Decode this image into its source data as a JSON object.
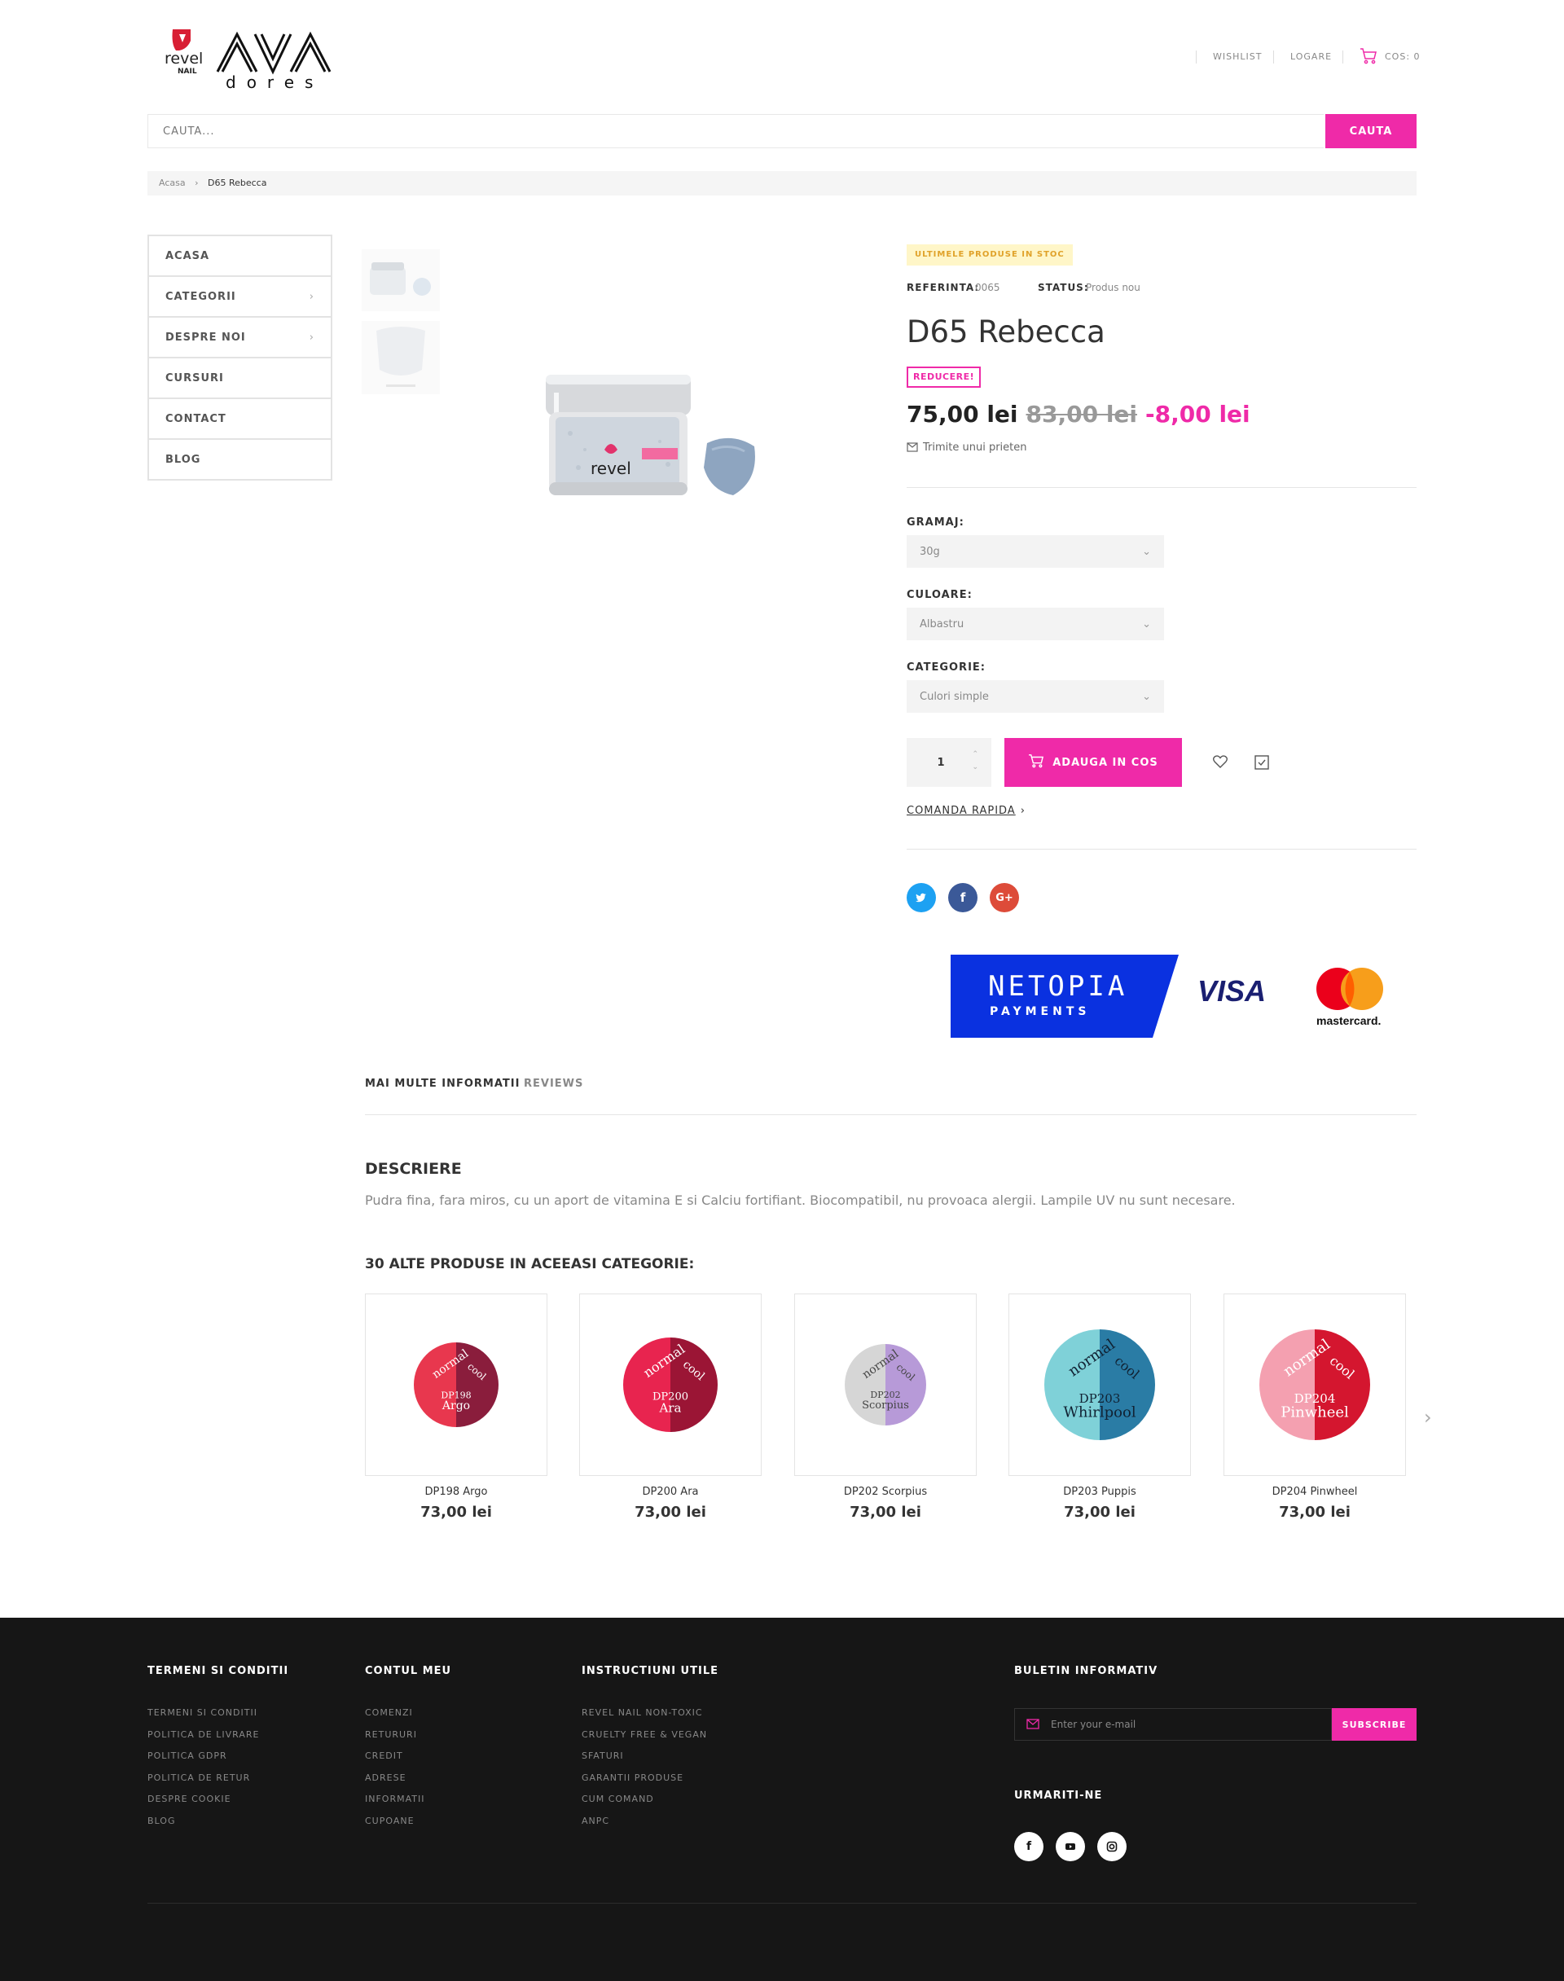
{
  "header": {
    "logo_revel_text": "revel",
    "logo_revel_sub": "NAIL",
    "logo_ava_text": "AVA",
    "logo_ava_sub": "dores",
    "wishlist": "WISHLIST",
    "login": "LOGARE",
    "cart": "COS: 0"
  },
  "search": {
    "placeholder": "CAUTA...",
    "button": "CAUTA"
  },
  "breadcrumb": {
    "home": "Acasa",
    "separator": "›",
    "current": "D65 Rebecca"
  },
  "menu": [
    {
      "label": "ACASA",
      "has_children": false
    },
    {
      "label": "CATEGORII",
      "has_children": true
    },
    {
      "label": "DESPRE NOI",
      "has_children": true
    },
    {
      "label": "CURSURI",
      "has_children": false
    },
    {
      "label": "CONTACT",
      "has_children": false
    },
    {
      "label": "BLOG",
      "has_children": false
    }
  ],
  "product": {
    "stock_badge": "ULTIMELE PRODUSE IN STOC",
    "ref_label": "REFERINTA:",
    "ref_value": "0065",
    "status_label": "STATUS:",
    "status_value": "Produs nou",
    "title": "D65 Rebecca",
    "jar_brand": "revel",
    "discount_badge": "REDUCERE!",
    "price": "75,00 lei",
    "old_price": "83,00 lei",
    "discount": "-8,00 lei",
    "send_friend": "Trimite unui prieten",
    "options": [
      {
        "label": "GRAMAJ:",
        "value": "30g"
      },
      {
        "label": "CULOARE:",
        "value": "Albastru"
      },
      {
        "label": "CATEGORIE:",
        "value": "Culori simple"
      }
    ],
    "quantity": "1",
    "add_to_cart": "ADAUGA IN COS",
    "quick_order": "COMANDA RAPIDA",
    "quick_order_arrow": "›"
  },
  "payment": {
    "netopia": "NETOPIA",
    "netopia_sub": "PAYMENTS",
    "visa": "VISA",
    "mastercard": "mastercard."
  },
  "tabs": [
    {
      "label": "MAI MULTE INFORMATII",
      "active": true
    },
    {
      "label": "REVIEWS",
      "active": false
    }
  ],
  "description": {
    "heading": "DESCRIERE",
    "text": "Pudra fina, fara miros, cu un aport de vitamina E si Calciu fortifiant. Biocompatibil, nu provoaca alergii. Lampile UV nu sunt necesare."
  },
  "related": {
    "heading": "30 ALTE PRODUSE IN ACEEASI CATEGORIE:",
    "items": [
      {
        "name": "DP198 Argo",
        "price": "73,00 lei",
        "swatch_label": "DP198\nArgo",
        "left": "#e8374e",
        "right": "#8a1d3c"
      },
      {
        "name": "DP200 Ara",
        "price": "73,00 lei",
        "swatch_label": "DP200\nAra",
        "left": "#e8244f",
        "right": "#9b1535"
      },
      {
        "name": "DP202 Scorpius",
        "price": "73,00 lei",
        "swatch_label": "DP202\nScorpius",
        "left": "#d6d6d6",
        "right": "#b79ad8"
      },
      {
        "name": "DP203 Puppis",
        "price": "73,00 lei",
        "swatch_label": "DP203\nWhirlpool",
        "left": "#7fd1d8",
        "right": "#2a7ca5"
      },
      {
        "name": "DP204 Pinwheel",
        "price": "73,00 lei",
        "swatch_label": "DP204\nPinwheel",
        "left": "#f4a0b0",
        "right": "#d4162f"
      }
    ],
    "swatch_normal": "normal",
    "swatch_cool": "cool"
  },
  "footer": {
    "col1": {
      "title": "TERMENI SI CONDITII",
      "links": [
        "TERMENI SI CONDITII",
        "POLITICA DE LIVRARE",
        "POLITICA GDPR",
        "POLITICA DE RETUR",
        "DESPRE COOKIE",
        "BLOG"
      ]
    },
    "col2": {
      "title": "CONTUL MEU",
      "links": [
        "COMENZI",
        "RETURURI",
        "CREDIT",
        "ADRESE",
        "INFORMATII",
        "CUPOANE"
      ]
    },
    "col3": {
      "title": "INSTRUCTIUNI UTILE",
      "links": [
        "REVEL NAIL NON-TOXIC",
        "CRUELTY FREE & VEGAN",
        "SFATURI",
        "GARANTII PRODUSE",
        "CUM COMAND",
        "ANPC"
      ]
    },
    "newsletter": {
      "title": "BULETIN INFORMATIV",
      "placeholder": "Enter your e-mail",
      "button": "SUBSCRIBE"
    },
    "follow": {
      "title": "URMARITI-NE"
    }
  },
  "colors": {
    "accent": "#ef2aa8",
    "footer_bg": "#161616",
    "netopia_blue": "#0a31e0",
    "visa_blue": "#1a1f71"
  }
}
